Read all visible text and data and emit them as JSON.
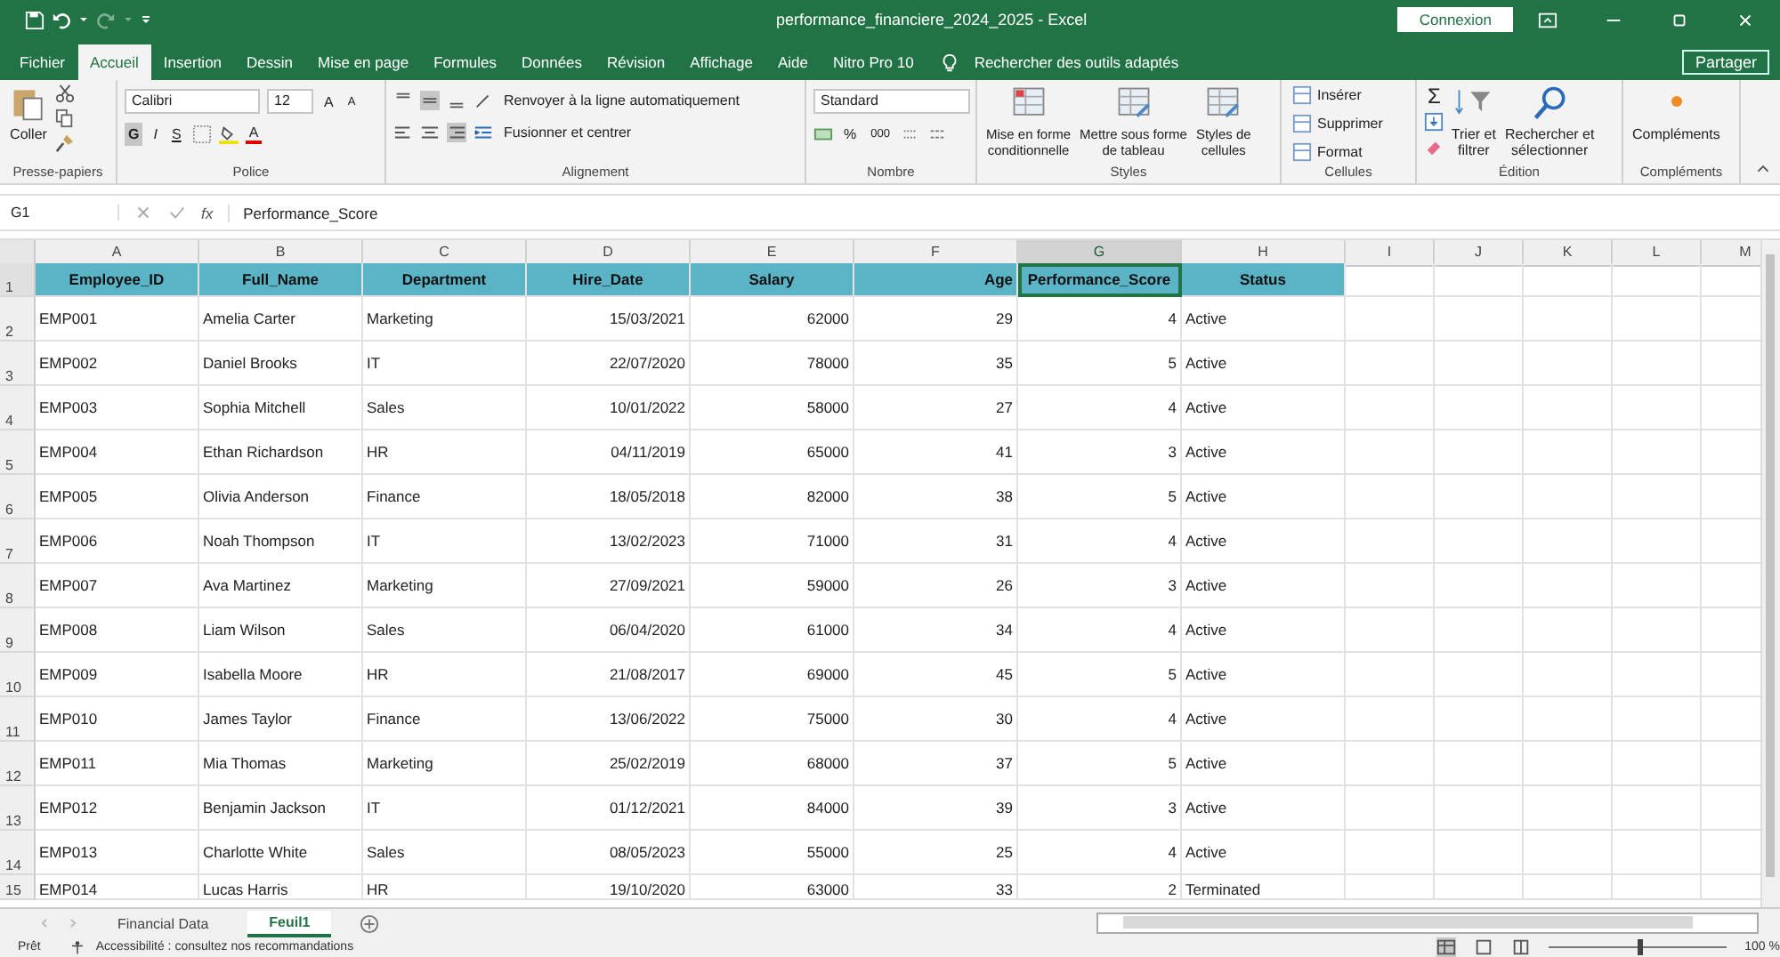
{
  "window": {
    "title": "performance_financiere_2024_2025  -  Excel",
    "signin": "Connexion"
  },
  "tabs": [
    {
      "label": "Fichier",
      "selected": false
    },
    {
      "label": "Accueil",
      "selected": true
    },
    {
      "label": "Insertion",
      "selected": false
    },
    {
      "label": "Dessin",
      "selected": false
    },
    {
      "label": "Mise en page",
      "selected": false
    },
    {
      "label": "Formules",
      "selected": false
    },
    {
      "label": "Données",
      "selected": false
    },
    {
      "label": "Révision",
      "selected": false
    },
    {
      "label": "Affichage",
      "selected": false
    },
    {
      "label": "Aide",
      "selected": false
    },
    {
      "label": "Nitro Pro 10",
      "selected": false
    }
  ],
  "search": {
    "placeholder": "Rechercher des outils adaptés"
  },
  "share": "Partager",
  "ribbon": {
    "groups": [
      {
        "kind": "clipboard",
        "label": "Presse-papiers",
        "paste": "Coller"
      },
      {
        "kind": "font",
        "label": "Police",
        "font": "Calibri",
        "size": "12",
        "grow": "A",
        "shrink": "A",
        "bold": {
          "label": "G",
          "on": true
        },
        "italic": "I",
        "underline": "S",
        "font_color": "A"
      },
      {
        "kind": "alignment",
        "label": "Alignement",
        "vertical": [
          false,
          true,
          false
        ],
        "horizontal": [
          false,
          false,
          true
        ],
        "wrap": "Renvoyer à la ligne automatiquement",
        "merge": "Fusionner et centrer"
      },
      {
        "kind": "number",
        "label": "Nombre",
        "format": "Standard",
        "percent": "%",
        "thousands": "000"
      },
      {
        "kind": "styles",
        "label": "Styles",
        "buttons": [
          [
            "Mise en forme",
            "conditionnelle"
          ],
          [
            "Mettre sous forme",
            "de tableau"
          ],
          [
            "Styles de",
            "cellules"
          ]
        ]
      },
      {
        "kind": "cells",
        "label": "Cellules",
        "buttons": [
          "Insérer",
          "Supprimer",
          "Format"
        ]
      },
      {
        "kind": "editing",
        "label": "Édition",
        "sum": "Σ",
        "buttons": [
          [
            "Trier et",
            "filtrer"
          ],
          [
            "Rechercher et",
            "sélectionner"
          ]
        ]
      },
      {
        "kind": "addins",
        "label": "Compléments",
        "button": "Compléments"
      }
    ]
  },
  "formula_bar": {
    "name_box": "G1",
    "fx": "fx",
    "content": "Performance_Score"
  },
  "columns": [
    {
      "label": "A",
      "selected": false
    },
    {
      "label": "B",
      "selected": false
    },
    {
      "label": "C",
      "selected": false
    },
    {
      "label": "D",
      "selected": false
    },
    {
      "label": "E",
      "selected": false
    },
    {
      "label": "F",
      "selected": false
    },
    {
      "label": "G",
      "selected": true
    },
    {
      "label": "H",
      "selected": false
    },
    {
      "label": "I",
      "selected": false
    },
    {
      "label": "J",
      "selected": false
    },
    {
      "label": "K",
      "selected": false
    },
    {
      "label": "L",
      "selected": false
    },
    {
      "label": "M",
      "selected": false
    }
  ],
  "header_row": {
    "number": "1",
    "selected": true,
    "cells": [
      {
        "text": "Employee_ID",
        "selected": false
      },
      {
        "text": "Full_Name",
        "selected": false
      },
      {
        "text": "Department",
        "selected": false
      },
      {
        "text": "Hire_Date",
        "selected": false
      },
      {
        "text": "Salary",
        "selected": false
      },
      {
        "text": "Age",
        "selected": false
      },
      {
        "text": "Performance_Score",
        "selected": true
      },
      {
        "text": "Status",
        "selected": false
      }
    ]
  },
  "rows": [
    {
      "number": "2",
      "cells": [
        "EMP001",
        "Amelia Carter",
        "Marketing",
        "15/03/2021",
        "62000",
        "29",
        "4",
        "Active"
      ]
    },
    {
      "number": "3",
      "cells": [
        "EMP002",
        "Daniel Brooks",
        "IT",
        "22/07/2020",
        "78000",
        "35",
        "5",
        "Active"
      ]
    },
    {
      "number": "4",
      "cells": [
        "EMP003",
        "Sophia Mitchell",
        "Sales",
        "10/01/2022",
        "58000",
        "27",
        "4",
        "Active"
      ]
    },
    {
      "number": "5",
      "cells": [
        "EMP004",
        "Ethan Richardson",
        "HR",
        "04/11/2019",
        "65000",
        "41",
        "3",
        "Active"
      ]
    },
    {
      "number": "6",
      "cells": [
        "EMP005",
        "Olivia Anderson",
        "Finance",
        "18/05/2018",
        "82000",
        "38",
        "5",
        "Active"
      ]
    },
    {
      "number": "7",
      "cells": [
        "EMP006",
        "Noah Thompson",
        "IT",
        "13/02/2023",
        "71000",
        "31",
        "4",
        "Active"
      ]
    },
    {
      "number": "8",
      "cells": [
        "EMP007",
        "Ava Martinez",
        "Marketing",
        "27/09/2021",
        "59000",
        "26",
        "3",
        "Active"
      ]
    },
    {
      "number": "9",
      "cells": [
        "EMP008",
        "Liam Wilson",
        "Sales",
        "06/04/2020",
        "61000",
        "34",
        "4",
        "Active"
      ]
    },
    {
      "number": "10",
      "cells": [
        "EMP009",
        "Isabella Moore",
        "HR",
        "21/08/2017",
        "69000",
        "45",
        "5",
        "Active"
      ]
    },
    {
      "number": "11",
      "cells": [
        "EMP010",
        "James Taylor",
        "Finance",
        "13/06/2022",
        "75000",
        "30",
        "4",
        "Active"
      ]
    },
    {
      "number": "12",
      "cells": [
        "EMP011",
        "Mia Thomas",
        "Marketing",
        "25/02/2019",
        "68000",
        "37",
        "5",
        "Active"
      ]
    },
    {
      "number": "13",
      "cells": [
        "EMP012",
        "Benjamin Jackson",
        "IT",
        "01/12/2021",
        "84000",
        "39",
        "3",
        "Active"
      ]
    },
    {
      "number": "14",
      "cells": [
        "EMP013",
        "Charlotte White",
        "Sales",
        "08/05/2023",
        "55000",
        "25",
        "4",
        "Active"
      ]
    },
    {
      "number": "15",
      "cells": [
        "EMP014",
        "Lucas Harris",
        "HR",
        "19/10/2020",
        "63000",
        "33",
        "2",
        "Terminated"
      ]
    }
  ],
  "sheets": [
    {
      "label": "Financial Data",
      "selected": false
    },
    {
      "label": "Feuil1",
      "selected": true
    }
  ],
  "status_bar": {
    "ready": "Prêt",
    "accessibility": "Accessibilité : consultez nos recommandations",
    "zoom": {
      "level": 0.5,
      "reading": "100 %"
    }
  }
}
